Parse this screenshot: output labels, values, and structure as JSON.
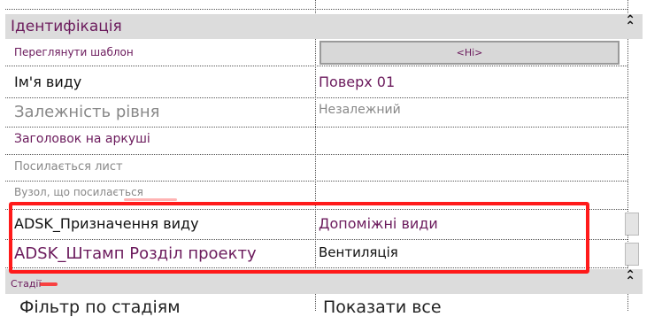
{
  "sections": {
    "identification": {
      "title": "Ідентифікація",
      "collapse_glyph": "⌃⌃"
    },
    "stages": {
      "title": "Стадії",
      "collapse_glyph": "⌃⌃"
    }
  },
  "rows": {
    "view_template": {
      "label": "Переглянути шаблон",
      "value": "<Ні>"
    },
    "view_name": {
      "label": "Ім'я виду",
      "value": "Поверх 01"
    },
    "level_dependency": {
      "label": "Залежність рівня",
      "value": "Незалежний"
    },
    "title_on_sheet": {
      "label": "Заголовок на аркуші",
      "value": ""
    },
    "referencing_sheet": {
      "label": "Посилається лист",
      "value": ""
    },
    "referencing_detail": {
      "label": "Вузол, що посилається",
      "value": ""
    },
    "adsk_view_purpose": {
      "label": "ADSK_Призначення виду",
      "value": "Допоміжні види"
    },
    "adsk_stamp_section": {
      "label": "ADSK_Штамп Розділ проекту",
      "value": "Вентиляція"
    }
  },
  "partial_rows": {
    "phase_filter": {
      "label": "Фільтр по стадіям",
      "value": "Показати все"
    }
  },
  "highlight": {
    "color": "#ff1a1a"
  }
}
